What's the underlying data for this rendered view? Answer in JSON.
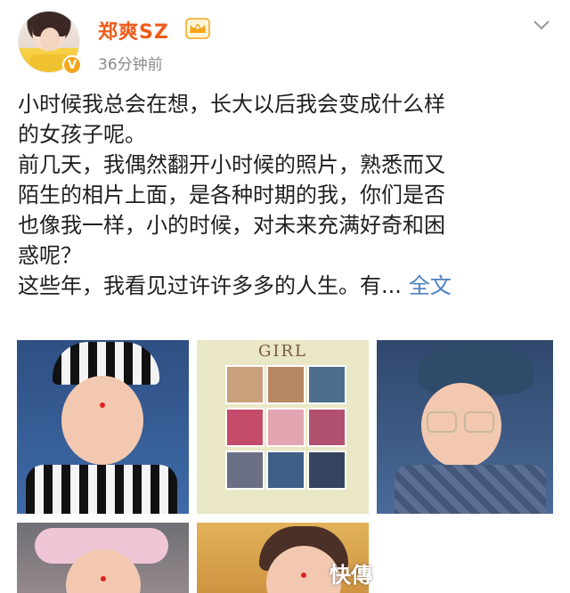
{
  "post": {
    "author": "郑爽SZ",
    "time_ago": "36分钟前",
    "verified_badge": "V",
    "lines": [
      "小时候我总会在想，长大以后我会变成什么样",
      "的女孩子呢。",
      "前几天，我偶然翻开小时候的照片，熟悉而又",
      "陌生的相片上面，是各种时期的我，你们是否",
      "也像我一样，小的时候，对未来充满好奇和困",
      "惑呢？",
      "这些年，我看见过许许多多的人生。有..."
    ],
    "more_link": "全文"
  },
  "images": {
    "collage_title": "GIRL",
    "count": 5
  },
  "watermark": "快傳",
  "colors": {
    "username": "#f05a1a",
    "link": "#4a7fc0",
    "time": "#8a8a8a",
    "verify": "#f3a51b"
  },
  "icons": {
    "crown": "crown-icon",
    "chevron": "chevron-down-icon",
    "verify": "verified-badge-icon"
  }
}
